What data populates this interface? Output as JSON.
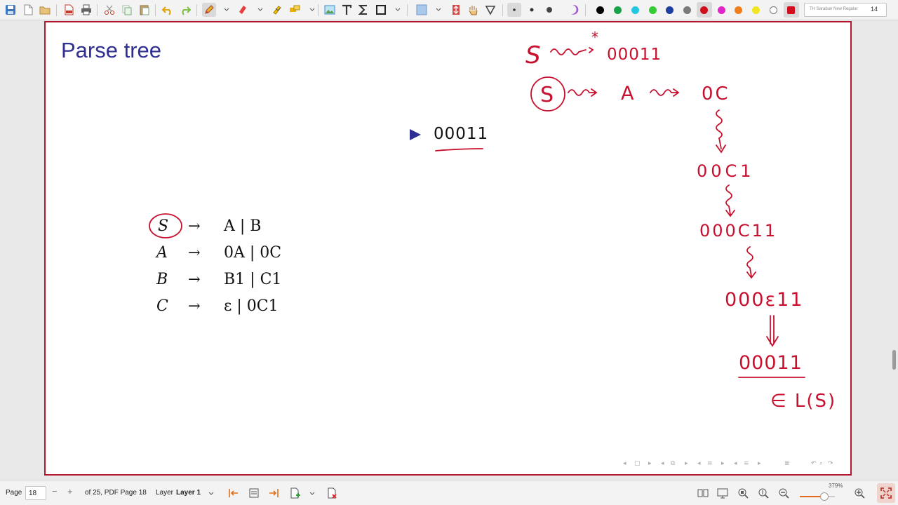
{
  "toolbar": {
    "font_name": "TH Sarabun New Regular",
    "font_size": "14",
    "colors": [
      "#000000",
      "#16a34a",
      "#22c7e0",
      "#33cc33",
      "#1f3fa0",
      "#7b7b7b",
      "#d10f1c",
      "#e026c6",
      "#f07e1a",
      "#f2e523",
      "#ffffff",
      "#d10f1c"
    ],
    "selected_color": "#d10f1c",
    "accent": "#b0192e"
  },
  "slide": {
    "title": "Parse tree",
    "bullet_text": "00011",
    "bullet_color": "#2e2e93"
  },
  "grammar": [
    {
      "lhs": "S",
      "rhs": "A | B"
    },
    {
      "lhs": "A",
      "rhs": "0A | 0C"
    },
    {
      "lhs": "B",
      "rhs": "B1 | C1"
    },
    {
      "lhs": "C",
      "rhs": "ε | 0C1"
    }
  ],
  "grammar_arrow": "→",
  "ink": {
    "color": "#c8102e",
    "derivation_top": "S ⇝* 00011",
    "derivation_start": "S ⇝ A ⇝ 0C",
    "steps": [
      "00C1",
      "000C11",
      "000ε11",
      "00011"
    ],
    "membership": "∈ L(S)"
  },
  "statusbar": {
    "page_label": "Page",
    "page_value": "18",
    "page_total": "of 25, PDF Page 18",
    "layer_label": "Layer",
    "layer_value": "Layer 1",
    "zoom_label": "379%",
    "zoom_fraction": 0.7
  }
}
